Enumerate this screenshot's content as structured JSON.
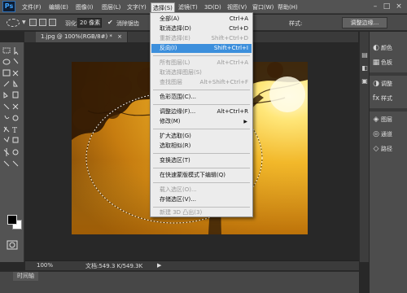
{
  "menubar": {
    "logo": "Ps",
    "items": [
      "文件(F)",
      "编辑(E)",
      "图像(I)",
      "图层(L)",
      "文字(Y)",
      "选择(S)",
      "滤镜(T)",
      "3D(D)",
      "视图(V)",
      "窗口(W)",
      "帮助(H)"
    ],
    "window_controls": [
      "–",
      "□",
      "×"
    ]
  },
  "options": {
    "feather_label": "羽化:",
    "feather_value": "20 像素",
    "antialias_check": "✔",
    "antialias_label": "消除锯齿",
    "style_label": "样式:",
    "refine_edge": "调整边缘..."
  },
  "document": {
    "tab_label": "1.jpg @ 100%(RGB/8#) *",
    "tab_close": "×"
  },
  "status": {
    "zoom": "100%",
    "doc_size": "文档:549.3 K/549.3K",
    "arrow": "▶"
  },
  "timeline": {
    "tab": "时间轴"
  },
  "panels": {
    "items": [
      "颜色",
      "色板",
      "调整",
      "样式",
      "图层",
      "通道",
      "路径"
    ]
  },
  "dropdown": {
    "items": [
      {
        "label": "全部(A)",
        "shortcut": "Ctrl+A",
        "disabled": false
      },
      {
        "label": "取消选择(D)",
        "shortcut": "Ctrl+D",
        "disabled": false
      },
      {
        "label": "重新选择(E)",
        "shortcut": "Shift+Ctrl+D",
        "disabled": true
      },
      {
        "label": "反向(I)",
        "shortcut": "Shift+Ctrl+I",
        "disabled": false,
        "highlighted": true
      },
      {
        "label": "所有图层(L)",
        "shortcut": "Alt+Ctrl+A",
        "disabled": true
      },
      {
        "label": "取消选择图层(S)",
        "shortcut": "",
        "disabled": true
      },
      {
        "label": "查找图层",
        "shortcut": "Alt+Shift+Ctrl+F",
        "disabled": true
      },
      {
        "label": "色彩范围(C)...",
        "shortcut": "",
        "disabled": false
      },
      {
        "label": "调整边缘(F)...",
        "shortcut": "Alt+Ctrl+R",
        "disabled": false
      },
      {
        "label": "修改(M)",
        "shortcut": "",
        "disabled": false,
        "submenu": "▶"
      },
      {
        "label": "扩大选取(G)",
        "shortcut": "",
        "disabled": false
      },
      {
        "label": "选取相似(R)",
        "shortcut": "",
        "disabled": false
      },
      {
        "label": "变换选区(T)",
        "shortcut": "",
        "disabled": false
      },
      {
        "label": "在快速蒙版模式下编辑(Q)",
        "shortcut": "",
        "disabled": false
      },
      {
        "label": "载入选区(O)...",
        "shortcut": "",
        "disabled": true
      },
      {
        "label": "存储选区(V)...",
        "shortcut": "",
        "disabled": false
      },
      {
        "label": "新建 3D 凸出(3)",
        "shortcut": "",
        "disabled": true
      }
    ]
  },
  "colors": {
    "menu_highlight": "#3c8fdc",
    "ui_dark": "#535353",
    "canvas_bg": "#282828"
  }
}
